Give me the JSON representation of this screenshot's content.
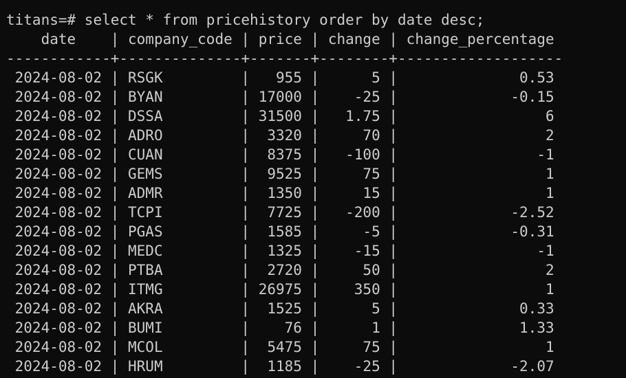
{
  "prompt": "titans=# ",
  "command": "select * from pricehistory order by date desc;",
  "columns": [
    "date",
    "company_code",
    "price",
    "change",
    "change_percentage"
  ],
  "rows": [
    [
      "2024-08-02",
      "RSGK",
      "955",
      "5",
      "0.53"
    ],
    [
      "2024-08-02",
      "BYAN",
      "17000",
      "-25",
      "-0.15"
    ],
    [
      "2024-08-02",
      "DSSA",
      "31500",
      "1.75",
      "6"
    ],
    [
      "2024-08-02",
      "ADRO",
      "3320",
      "70",
      "2"
    ],
    [
      "2024-08-02",
      "CUAN",
      "8375",
      "-100",
      "-1"
    ],
    [
      "2024-08-02",
      "GEMS",
      "9525",
      "75",
      "1"
    ],
    [
      "2024-08-02",
      "ADMR",
      "1350",
      "15",
      "1"
    ],
    [
      "2024-08-02",
      "TCPI",
      "7725",
      "-200",
      "-2.52"
    ],
    [
      "2024-08-02",
      "PGAS",
      "1585",
      "-5",
      "-0.31"
    ],
    [
      "2024-08-02",
      "MEDC",
      "1325",
      "-15",
      "-1"
    ],
    [
      "2024-08-02",
      "PTBA",
      "2720",
      "50",
      "2"
    ],
    [
      "2024-08-02",
      "ITMG",
      "26975",
      "350",
      "1"
    ],
    [
      "2024-08-02",
      "AKRA",
      "1525",
      "5",
      "0.33"
    ],
    [
      "2024-08-02",
      "BUMI",
      "76",
      "1",
      "1.33"
    ],
    [
      "2024-08-02",
      "MCOL",
      "5475",
      "75",
      "1"
    ],
    [
      "2024-08-02",
      "HRUM",
      "1185",
      "-25",
      "-2.07"
    ]
  ],
  "colors": {
    "background": "#0c0c0c",
    "text": "#cccccc"
  }
}
